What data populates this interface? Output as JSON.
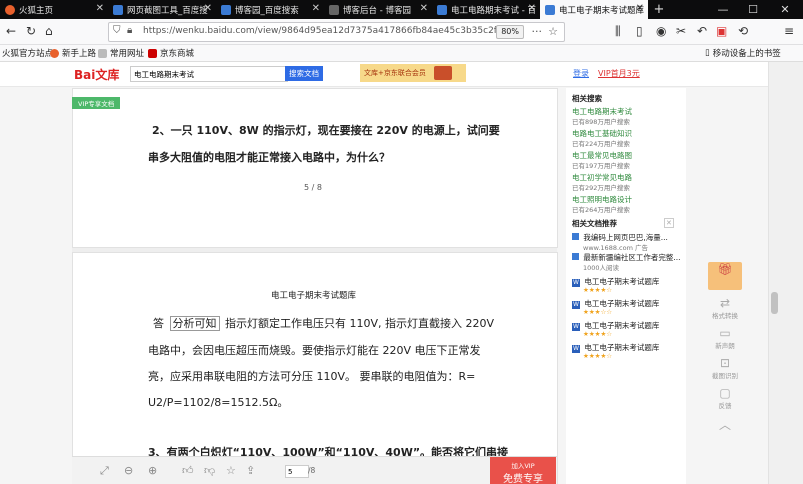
{
  "tabs": [
    {
      "label": "火狐主页",
      "color": "#e8602c"
    },
    {
      "label": "网页截图工具_百度搜",
      "color": "#3b7bd4"
    },
    {
      "label": "博客园_百度搜索",
      "color": "#3b7bd4"
    },
    {
      "label": "博客后台 - 博客园",
      "color": "#555"
    },
    {
      "label": "电工电路期末考试 - 百",
      "color": "#3b7bd4"
    },
    {
      "label": "电工电子期末考试题库",
      "color": "#3b7bd4"
    }
  ],
  "url": "https://wenku.baidu.com/view/9864d95ea12d7375a417866fb84ae45c3b35c2fc.h",
  "zoom": "80%",
  "bookmarks": [
    {
      "label": "火狐官方站点",
      "color": "#e8602c"
    },
    {
      "label": "新手上路",
      "color": "#e8602c"
    },
    {
      "label": "常用网址",
      "color": "#999"
    },
    {
      "label": "京东商城",
      "color": "#c00"
    }
  ],
  "bookmarks_mobile": "移动设备上的书签",
  "header": {
    "logo": "Bai文库",
    "search_value": "电工电路期末考试",
    "search_button": "搜索文档",
    "ad_text": "文库+京东联合会员",
    "login": "登录",
    "vip": "VIP首月3元"
  },
  "page1": {
    "badge": "VIP专享文档",
    "question_line1": "2、一只 110V、8W 的指示灯，现在要接在 220V 的电源上，试问要",
    "question_line2": "串多大阻值的电阻才能正常接入电路中，为什么？",
    "page_num": "5 / 8"
  },
  "page2": {
    "title": "电工电子期末考试题库",
    "answer_label": "答",
    "answer_box": "分析可知",
    "answer_line1": "指示灯额定工作电压只有 110V, 指示灯直截接入 220V",
    "answer_line2": "电路中，会因电压超压而烧毁。要使指示灯能在 220V 电压下正常发",
    "answer_line3": "亮，应采用串联电阻的方法可分压  110V。 要串联的电阻值为：R=",
    "answer_line4": "U2/P=1102/8=1512.5Ω。",
    "question3": "3、有两个白炽灯“110V、100W”和“110V、40W”。能否将它们串接"
  },
  "related_search": {
    "title": "相关搜索",
    "items": [
      {
        "label": "电工电路期末考试",
        "sub": "已有898万用户搜索"
      },
      {
        "label": "电路电工基础知识",
        "sub": "已有224万用户搜索"
      },
      {
        "label": "电工最常见电路图",
        "sub": "已有197万用户搜索"
      },
      {
        "label": "电工初学常见电路",
        "sub": "已有292万用户搜索"
      },
      {
        "label": "电工照明电路设计",
        "sub": "已有264万用户搜索"
      }
    ]
  },
  "related_docs": {
    "title": "相关文档推荐",
    "items": [
      {
        "label": "我编码上网页巴巴,海量...",
        "sub": "www.1688.com   广告",
        "stars": ""
      },
      {
        "label": "最新新疆编社区工作者完整...",
        "sub": "1000人阅读",
        "stars": ""
      },
      {
        "label": "电工电子期末考试题库",
        "sub": "",
        "stars": "★★★★☆"
      },
      {
        "label": "电工电子期末考试题库",
        "sub": "",
        "stars": "★★★☆☆"
      },
      {
        "label": "电工电子期末考试题库",
        "sub": "",
        "stars": "★★★★☆"
      },
      {
        "label": "电工电子期末考试题库",
        "sub": "",
        "stars": "★★★★☆"
      }
    ]
  },
  "tools": [
    {
      "label": "格式转换"
    },
    {
      "label": "新声朗"
    },
    {
      "label": "截图识别"
    },
    {
      "label": "反馈"
    }
  ],
  "bottombar": {
    "page_input": "5",
    "page_total": "/8",
    "vip_small": "加入VIP",
    "vip_big": "免费专享"
  }
}
